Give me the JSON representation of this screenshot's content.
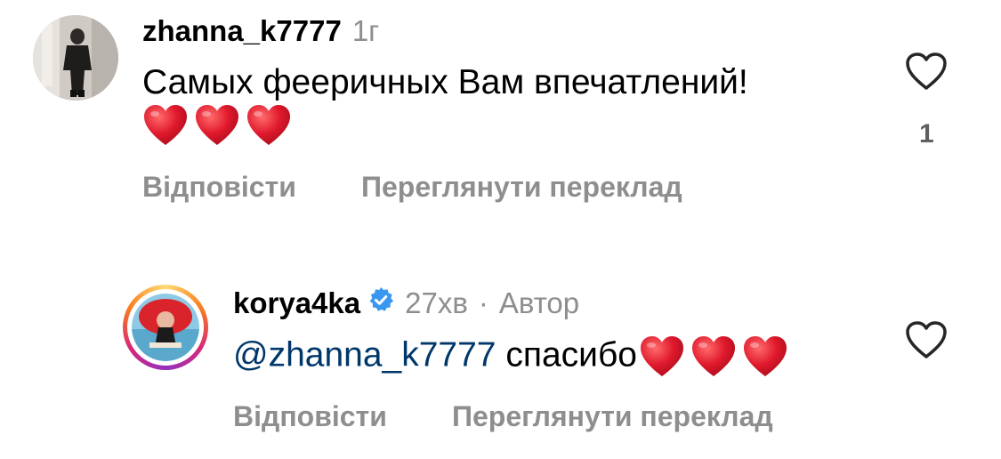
{
  "comments": [
    {
      "username": "zhanna_k7777",
      "time": "1г",
      "text": "Самых фееричных Вам впечатлений!",
      "emoji": "❤️❤️❤️",
      "like_count": "1",
      "reply_label": "Відповісти",
      "translate_label": "Переглянути переклад"
    },
    {
      "username": "korya4ka",
      "verified": true,
      "time": "27хв",
      "separator": "·",
      "author_label": "Автор",
      "mention": "@zhanna_k7777",
      "text": "спасибо",
      "emoji": "❤️❤️❤️",
      "reply_label": "Відповісти",
      "translate_label": "Переглянути переклад"
    }
  ],
  "colors": {
    "text": "#000000",
    "secondary": "#8e8e8e",
    "mention": "#00376b",
    "verified": "#3897f0",
    "heart": "#e0192d"
  },
  "icons": {
    "like": "heart-outline-icon",
    "verified": "verified-badge-icon",
    "emoji": "red-heart-emoji"
  }
}
